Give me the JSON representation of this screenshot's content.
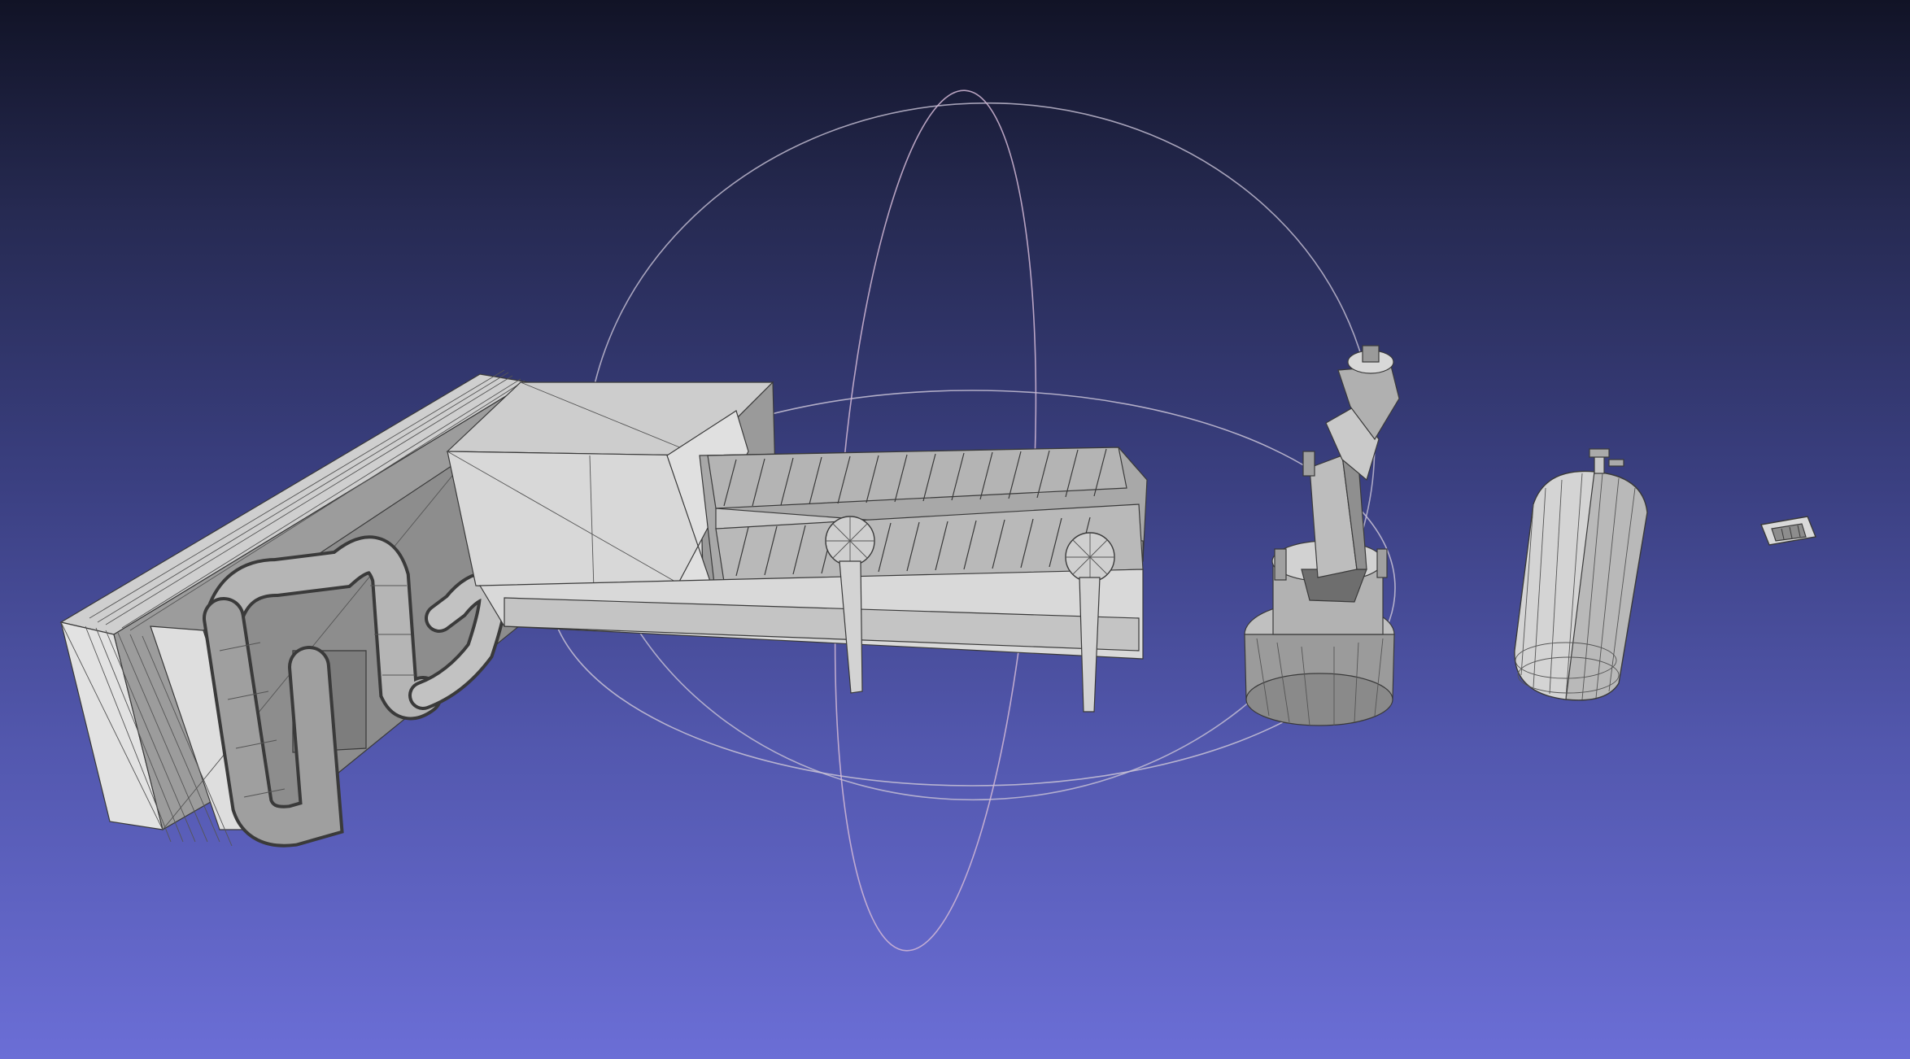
{
  "app": {
    "kind": "3d-mesh-viewer",
    "render_mode": "flat-shaded-with-wireframe"
  },
  "colors": {
    "background_top": "#111326",
    "background_bottom": "#6b6ed6",
    "trackball_ring": "#c8c2d6",
    "mesh_light": "#d9d9d9",
    "mesh_mid": "#a9a9a9",
    "mesh_dark": "#6c6c6c",
    "wire": "#3a3a3a"
  },
  "scene": {
    "objects": [
      {
        "name": "radiator-block"
      },
      {
        "name": "duct-pipes"
      },
      {
        "name": "conveyor-belt"
      },
      {
        "name": "robotic-arm"
      },
      {
        "name": "gas-cylinder"
      },
      {
        "name": "small-plate"
      }
    ],
    "trackball_visible": true
  }
}
